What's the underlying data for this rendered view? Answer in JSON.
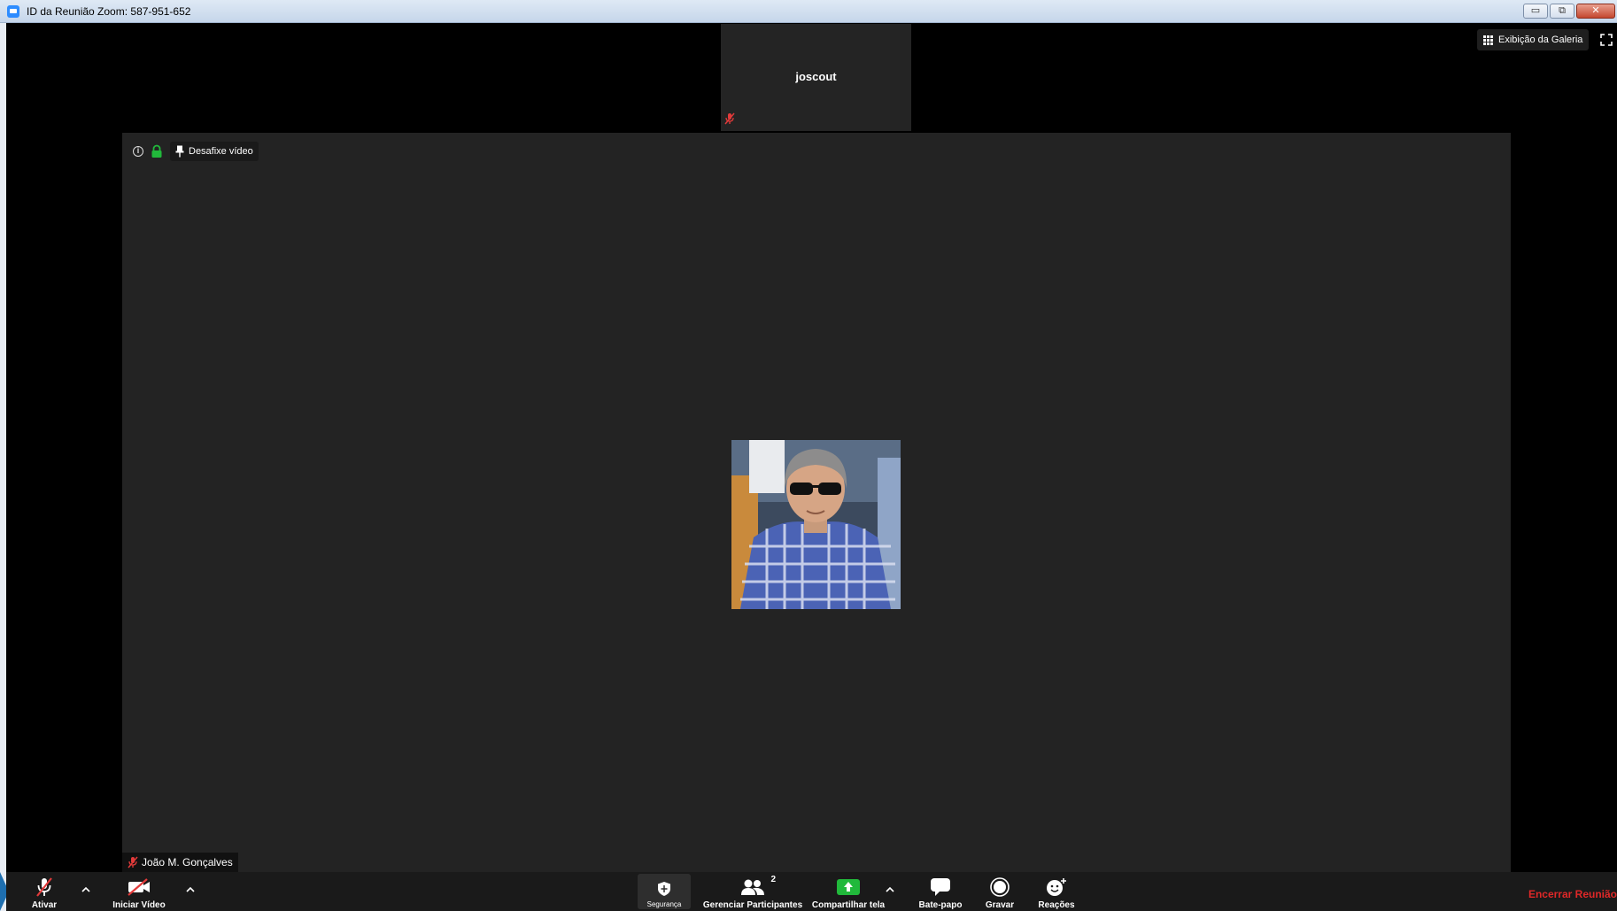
{
  "window": {
    "title": "ID da Reunião Zoom: 587-951-652",
    "buttons": {
      "minimize": "▭",
      "restore": "⧉",
      "close": "✕"
    }
  },
  "thumbnail": {
    "name": "joscout",
    "mic_icon": "mic-muted-icon"
  },
  "top_controls": {
    "gallery_label": "Exibição da Galeria",
    "fullscreen_icon": "fullscreen-icon"
  },
  "stage": {
    "unpin_label": "Desafixe vídeo",
    "participant_name": "João M. Gonçalves"
  },
  "toolbar": {
    "mute_label": "Ativar",
    "video_label": "Iniciar Vídeo",
    "security_label": "Segurança",
    "participants_label": "Gerenciar Participantes",
    "participants_count": "2",
    "share_label": "Compartilhar tela",
    "chat_label": "Bate-papo",
    "record_label": "Gravar",
    "reactions_label": "Reações",
    "end_label": "Encerrar Reunião"
  },
  "colors": {
    "accent_blue": "#2d8cff",
    "share_green": "#21b93b",
    "end_red": "#e02828",
    "muted_red": "#e23a3a"
  }
}
